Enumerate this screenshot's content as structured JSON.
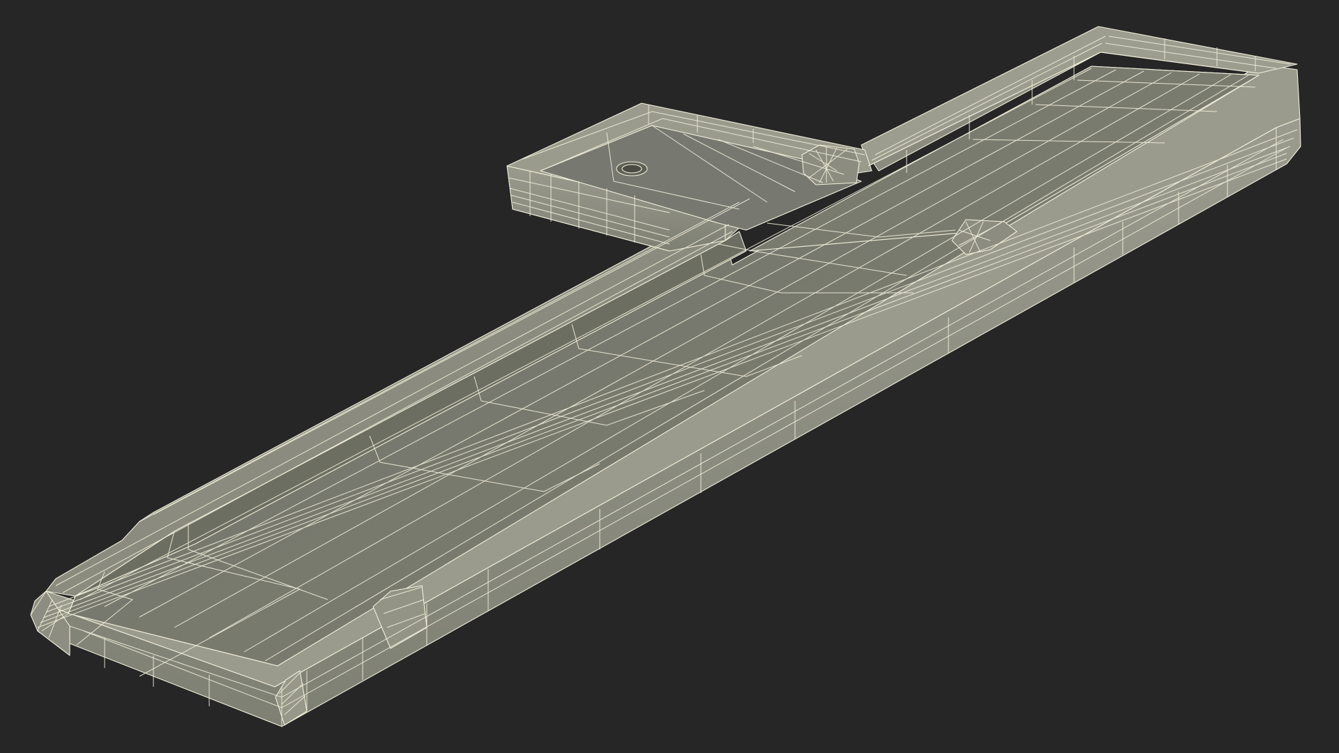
{
  "scene": {
    "subject": "wireframe-3d-model-tray",
    "colors": {
      "background": "#262626",
      "floor_face": "#7b7c6f",
      "wall_outer": "#8a8b7e",
      "wall_top": "#9a9b8d",
      "wall_inner": "#6d6e62",
      "wire": "#f2f0dc"
    }
  }
}
